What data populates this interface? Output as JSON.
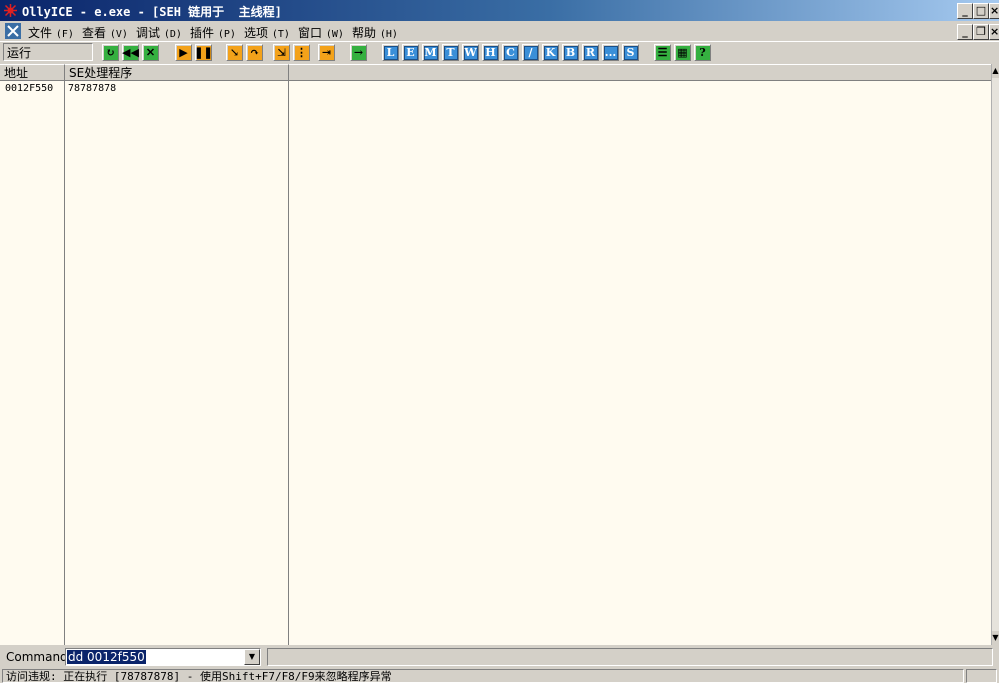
{
  "window": {
    "title": "OllyICE - e.exe - [SEH 链用于  主线程]"
  },
  "menu": [
    {
      "label": "文件",
      "accel": "(F)"
    },
    {
      "label": "查看",
      "accel": "(V)"
    },
    {
      "label": "调试",
      "accel": "(D)"
    },
    {
      "label": "插件",
      "accel": "(P)"
    },
    {
      "label": "选项",
      "accel": "(T)"
    },
    {
      "label": "窗口",
      "accel": "(W)"
    },
    {
      "label": "帮助",
      "accel": "(H)"
    }
  ],
  "toolbar": {
    "run_state": "运行",
    "letters": [
      "L",
      "E",
      "M",
      "T",
      "W",
      "H",
      "C",
      "/",
      "K",
      "B",
      "R",
      "...",
      "S"
    ]
  },
  "table": {
    "columns": [
      "地址",
      "SE处理程序"
    ],
    "rows": [
      {
        "address": "0012F550",
        "handler": "78787878"
      }
    ]
  },
  "command": {
    "label": "Command",
    "value": "dd 0012f550"
  },
  "status": {
    "text": "访问违规: 正在执行 [78787878] - 使用Shift+F7/F8/F9来忽略程序异常"
  },
  "colors": {
    "title_start": "#0a246a",
    "title_end": "#a6caf0",
    "pane_bg": "#fffbf0",
    "letter_btn": "#3a8fd8"
  }
}
